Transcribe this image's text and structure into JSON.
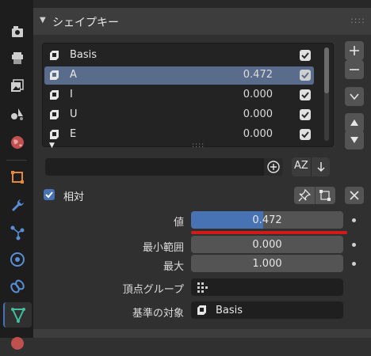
{
  "colors": {
    "accent": "#4772b3",
    "selected_row": "#5a6c8c",
    "annotation_line": "#d11a1a",
    "field_bg": "#545454"
  },
  "panel": {
    "title": "シェイプキー"
  },
  "shape_keys": [
    {
      "name": "Basis",
      "value": "",
      "enabled": true,
      "selected": false
    },
    {
      "name": "A",
      "value": "0.472",
      "enabled": true,
      "selected": true
    },
    {
      "name": "I",
      "value": "0.000",
      "enabled": true,
      "selected": false
    },
    {
      "name": "U",
      "value": "0.000",
      "enabled": true,
      "selected": false
    },
    {
      "name": "E",
      "value": "0.000",
      "enabled": true,
      "selected": false
    }
  ],
  "filter": {
    "value": "",
    "sort_label": "AZ"
  },
  "relative": {
    "label": "相対",
    "checked": true
  },
  "properties": {
    "value_label": "値",
    "value": "0.472",
    "value_fraction": 0.472,
    "min_label": "最小範囲",
    "min_value": "0.000",
    "max_label": "最大",
    "max_value": "1.000",
    "vertex_group_label": "頂点グループ",
    "vertex_group_value": "",
    "relative_to_label": "基準の対象",
    "relative_to_value": "Basis"
  },
  "tabs": [
    {
      "icon": "render-icon",
      "active": false
    },
    {
      "icon": "output-icon",
      "active": false
    },
    {
      "icon": "view-layer-icon",
      "active": false
    },
    {
      "icon": "scene-icon",
      "active": false
    },
    {
      "icon": "world-icon",
      "active": false
    },
    {
      "icon": "object-icon",
      "active": false
    },
    {
      "icon": "modifier-wrench-icon",
      "active": false
    },
    {
      "icon": "particles-icon",
      "active": false
    },
    {
      "icon": "physics-icon",
      "active": false
    },
    {
      "icon": "constraints-icon",
      "active": false
    },
    {
      "icon": "object-data-icon",
      "active": true
    }
  ]
}
